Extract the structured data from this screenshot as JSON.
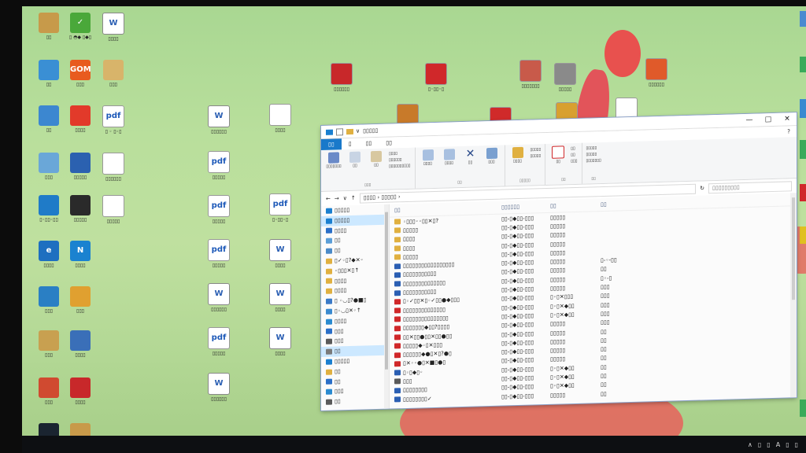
{
  "desktop": {
    "left_icons": [
      {
        "label": "▯▯",
        "glyph": "",
        "color": "#c79a4a",
        "kind": "folder"
      },
      {
        "label": "▯ ◓◆ ▯◆▯",
        "glyph": "✓",
        "color": "#4aa83a",
        "kind": "app"
      },
      {
        "label": "▯▯▯▯",
        "glyph": "W",
        "color": "#ffffff",
        "kind": "doc-w"
      },
      {
        "label": "▯▯",
        "glyph": "",
        "color": "#3a8fd4",
        "kind": "app"
      },
      {
        "label": "▯▯▯",
        "glyph": "GOM",
        "color": "#e85b1f",
        "kind": "app"
      },
      {
        "label": "▯▯▯",
        "glyph": "",
        "color": "#d8b46a",
        "kind": "app"
      },
      {
        "label": "▯▯",
        "glyph": "",
        "color": "#3c87d0",
        "kind": "app"
      },
      {
        "label": "▯▯▯▯",
        "glyph": "",
        "color": "#e23a2a",
        "kind": "app"
      },
      {
        "label": "▯ ◦ ▯◦▯",
        "glyph": "pdf",
        "color": "#ffffff",
        "kind": "doc"
      },
      {
        "label": "▯▯▯",
        "glyph": "",
        "color": "#6aa7d8",
        "kind": "app"
      },
      {
        "label": "▯▯▯▯▯",
        "glyph": "",
        "color": "#2b61b0",
        "kind": "app"
      },
      {
        "label": "▯▯▯▯▯▯",
        "glyph": "",
        "color": "#ffffff",
        "kind": "doc"
      },
      {
        "label": "▯◦▯▯◦▯▯",
        "glyph": "",
        "color": "#1f7bc8",
        "kind": "app"
      },
      {
        "label": "▯▯▯▯▯",
        "glyph": "",
        "color": "#2a2a2a",
        "kind": "app"
      },
      {
        "label": "▯▯▯▯▯",
        "glyph": "",
        "color": "#ffffff",
        "kind": "doc"
      },
      {
        "label": "▯▯▯▯",
        "glyph": "e",
        "color": "#1e6fc0",
        "kind": "app"
      },
      {
        "label": "▯▯▯▯",
        "glyph": "N",
        "color": "#1a82d0",
        "kind": "app"
      },
      {
        "label": "▯▯▯",
        "glyph": "",
        "color": "#2a7fc4",
        "kind": "app"
      },
      {
        "label": "▯▯▯",
        "glyph": "",
        "color": "#e0a030",
        "kind": "app"
      },
      {
        "label": "▯▯▯",
        "glyph": "",
        "color": "#c8a050",
        "kind": "folder"
      },
      {
        "label": "▯▯▯▯",
        "glyph": "",
        "color": "#3a6fb8",
        "kind": "app"
      },
      {
        "label": "▯▯▯",
        "glyph": "",
        "color": "#d04a30",
        "kind": "app"
      },
      {
        "label": "▯▯▯▯",
        "glyph": "",
        "color": "#c8282a",
        "kind": "app"
      },
      {
        "label": "▯▯▯",
        "glyph": "",
        "color": "#1a2430",
        "kind": "app"
      },
      {
        "label": "▯▯▯",
        "glyph": "",
        "color": "#c89a4a",
        "kind": "folder"
      }
    ],
    "mid_icons": [
      {
        "label": "▯▯▯▯▯▯",
        "glyph": "W",
        "kind": "doc-w"
      },
      {
        "label": "▯▯▯▯",
        "glyph": "",
        "kind": "doc"
      },
      {
        "label": "▯▯▯▯▯",
        "glyph": "pdf",
        "kind": "doc"
      },
      {
        "label": "▯▯▯▯▯",
        "glyph": "pdf",
        "kind": "doc"
      },
      {
        "label": "▯◦▯▯◦▯",
        "glyph": "pdf",
        "kind": "doc"
      },
      {
        "label": "▯▯▯▯▯",
        "glyph": "pdf",
        "kind": "doc"
      },
      {
        "label": "▯▯▯▯",
        "glyph": "W",
        "kind": "doc-w"
      },
      {
        "label": "▯▯▯▯▯▯",
        "glyph": "W",
        "kind": "doc-w"
      },
      {
        "label": "▯▯▯▯",
        "glyph": "W",
        "kind": "doc-w"
      },
      {
        "label": "▯▯▯▯▯",
        "glyph": "pdf",
        "kind": "doc"
      },
      {
        "label": "▯▯▯▯",
        "glyph": "W",
        "kind": "doc-w"
      },
      {
        "label": "▯▯▯▯▯▯",
        "glyph": "W",
        "kind": "doc-w"
      }
    ],
    "top_icons": [
      {
        "label": "▯▯▯▯▯▯",
        "color": "#c8282a"
      },
      {
        "label": "▯◦▯▯◦▯",
        "color": "#d0282a"
      },
      {
        "label": "▯▯▯▯▯▯▯",
        "color": "#c85a4a"
      },
      {
        "label": "▯▯▯▯▯",
        "color": "#8a8a8a"
      },
      {
        "label": "▯▯▯▯▯▯",
        "color": "#e05a2a"
      },
      {
        "label": "▯▯",
        "color": "#c87a2a"
      },
      {
        "label": "▯▯▯▯",
        "color": "#d02a2a"
      },
      {
        "label": "▯▯▯",
        "color": "#d8a030"
      },
      {
        "label": "▯▯▯▯",
        "color": "#ffffff"
      }
    ]
  },
  "explorer": {
    "title": "▯▯▯▯▯",
    "titlebar_icons": [
      "folder-icon",
      "check-icon",
      "folder-icon",
      "chevron-down-icon"
    ],
    "window_buttons": [
      "—",
      "□",
      "✕"
    ],
    "tabs": [
      "▯▯",
      "▯",
      "▯▯",
      "▯▯"
    ],
    "ribbon": {
      "clipboard": {
        "pin": "▯▯▯▯▯▯▯",
        "copy": "▯▯",
        "paste": "▯▯",
        "cut": "▯▯▯▯",
        "copy_path": "▯▯▯▯▯▯",
        "paste_shortcut": "▯▯▯▯▯▯▯▯▯▯",
        "group": "▯▯▯"
      },
      "organize": {
        "move": "▯▯▯▯",
        "copy": "▯▯▯▯",
        "delete": "▯▯",
        "rename": "▯▯▯",
        "group": "▯▯"
      },
      "new": {
        "new_folder": "▯▯▯▯",
        "new_item": "▯▯▯▯▯",
        "easy_access": "▯▯▯▯▯",
        "group": "▯▯▯▯▯"
      },
      "open": {
        "properties": "▯▯",
        "open": "▯▯",
        "edit": "▯▯",
        "history": "▯▯▯",
        "group": "▯▯"
      },
      "select": {
        "select_all": "▯▯▯▯▯",
        "select_none": "▯▯▯▯▯",
        "invert": "▯▯▯▯▯▯▯",
        "group": "▯▯"
      }
    },
    "address": {
      "nav": [
        "←",
        "→",
        "∨",
        "↑"
      ],
      "path": "▯▯▯▯ › ▯▯▯▯▯ ›",
      "search_placeholder": "▯▯▯▯▯▯▯▯▯"
    },
    "nav_pane": [
      {
        "label": "▯▯▯▯▯",
        "color": "#1a7fd0",
        "sel": false
      },
      {
        "label": "▯▯▯▯▯",
        "color": "#1a7fd0",
        "sel": true
      },
      {
        "label": "▯▯▯▯",
        "color": "#2a6fc8",
        "sel": false
      },
      {
        "label": "▯▯",
        "color": "#5a9ed8",
        "sel": false
      },
      {
        "label": "▯▯",
        "color": "#4a8ac8",
        "sel": false
      },
      {
        "label": "▯✓◦▯?◆✕◦",
        "color": "#e0b040",
        "sel": false
      },
      {
        "label": "◦▯▯▯✕▯↑",
        "color": "#e0b040",
        "sel": false
      },
      {
        "label": "▯▯▯▯",
        "color": "#e0b040",
        "sel": false
      },
      {
        "label": "▯▯▯▯",
        "color": "#e0b040",
        "sel": false
      },
      {
        "label": "▯ ◦◡▯?●■▯",
        "color": "#3a7ac8",
        "sel": false
      },
      {
        "label": "▯◦◡▯✕◦↑",
        "color": "#3a8ad0",
        "sel": false
      },
      {
        "label": "▯▯▯▯",
        "color": "#2a8ad0",
        "sel": false
      },
      {
        "label": "▯▯▯",
        "color": "#2a6fc8",
        "sel": false
      },
      {
        "label": "▯▯▯",
        "color": "#5a5a5a",
        "sel": false
      },
      {
        "label": "▯▯",
        "color": "#7a7a7a",
        "sel": true
      },
      {
        "label": "▯▯▯▯▯",
        "color": "#1a7fd0",
        "sel": false
      },
      {
        "label": "▯▯",
        "color": "#e0b040",
        "sel": false
      },
      {
        "label": "▯▯",
        "color": "#2a6fc8",
        "sel": false
      },
      {
        "label": "▯▯▯",
        "color": "#2a8ad0",
        "sel": false
      },
      {
        "label": "▯▯",
        "color": "#5a5a5a",
        "sel": false
      }
    ],
    "columns": [
      "▯▯",
      "▯▯▯▯▯▯",
      "▯▯",
      "▯▯"
    ],
    "files": [
      {
        "name": "◦▯▯▯◦◦▯▯✕▯?",
        "date": "▯▯-▯◆▯▯-▯▯▯",
        "type": "▯▯▯▯▯",
        "size": "",
        "icon": "#e0b040"
      },
      {
        "name": "▯▯▯▯▯",
        "date": "▯▯-▯◆▯▯-▯▯▯",
        "type": "▯▯▯▯▯",
        "size": "",
        "icon": "#e0b040"
      },
      {
        "name": "▯▯▯▯",
        "date": "▯▯-▯◆▯▯-▯▯▯",
        "type": "▯▯▯▯▯",
        "size": "",
        "icon": "#e0b040"
      },
      {
        "name": "▯▯▯▯",
        "date": "▯▯-▯◆▯▯-▯▯▯",
        "type": "▯▯▯▯▯",
        "size": "",
        "icon": "#e0b040"
      },
      {
        "name": "▯▯▯▯▯",
        "date": "▯▯-▯◆▯▯-▯▯▯",
        "type": "▯▯▯▯▯",
        "size": "",
        "icon": "#e0b040"
      },
      {
        "name": "▯▯▯▯▯▯▯▯▯▯▯▯▯▯▯▯▯",
        "date": "▯▯-▯◆▯▯-▯▯▯",
        "type": "▯▯▯▯▯",
        "size": "▯-◦-▯▯",
        "icon": "#2b5fb3"
      },
      {
        "name": "▯▯▯▯▯▯▯▯▯▯▯",
        "date": "▯▯-▯◆▯▯-▯▯▯",
        "type": "▯▯▯▯▯",
        "size": "▯▯",
        "icon": "#2b5fb3"
      },
      {
        "name": "▯▯▯▯▯▯▯▯▯▯▯▯▯▯",
        "date": "▯▯-▯◆▯▯-▯▯▯",
        "type": "▯▯▯▯▯",
        "size": "▯◦-▯",
        "icon": "#2b5fb3"
      },
      {
        "name": "▯▯▯▯▯▯▯▯▯▯▯",
        "date": "▯▯-▯◆▯▯-▯▯▯",
        "type": "▯▯▯▯▯",
        "size": "▯▯▯",
        "icon": "#2b5fb3"
      },
      {
        "name": "▯◦✓▯▯✕▯◦✓▯▯●◆▯▯▯",
        "date": "▯▯-▯◆▯▯-▯▯▯",
        "type": "▯◦▯✕▯▯▯",
        "size": "▯▯▯",
        "icon": "#d0282a"
      },
      {
        "name": "▯▯▯▯▯▯▯▯▯▯▯▯▯▯",
        "date": "▯▯-▯◆▯▯-▯▯▯",
        "type": "▯◦▯✕◆▯▯",
        "size": "▯▯▯",
        "icon": "#d0282a"
      },
      {
        "name": "▯▯▯▯▯▯▯▯▯▯▯▯▯▯▯",
        "date": "▯▯-▯◆▯▯-▯▯▯",
        "type": "▯◦▯✕◆▯▯",
        "size": "▯▯▯",
        "icon": "#d0282a"
      },
      {
        "name": "▯▯▯▯▯▯▯◆▯▯?▯▯▯▯",
        "date": "▯▯-▯◆▯▯-▯▯▯",
        "type": "▯▯▯▯▯",
        "size": "▯▯▯",
        "icon": "#d0282a"
      },
      {
        "name": "▯▯✕▯▯●▯▯✕▯▯●▯▯",
        "date": "▯▯-▯◆▯▯-▯▯▯",
        "type": "▯▯▯▯▯",
        "size": "▯▯",
        "icon": "#d0282a"
      },
      {
        "name": "▯▯▯▯▯◆◦▯✕▯▯▯",
        "date": "▯▯-▯◆▯▯-▯▯▯",
        "type": "▯▯▯▯▯",
        "size": "▯▯",
        "icon": "#d0282a"
      },
      {
        "name": "▯▯▯▯▯▯◆●▯✕▯?●▯",
        "date": "▯▯-▯◆▯▯-▯▯▯",
        "type": "▯▯▯▯▯",
        "size": "▯▯",
        "icon": "#d0282a"
      },
      {
        "name": "▯✕◦◦●▯✕■▯●▯",
        "date": "▯▯-▯◆▯▯-▯▯▯",
        "type": "▯▯▯▯▯",
        "size": "▯▯",
        "icon": "#d0282a"
      },
      {
        "name": "▯◦▯◆▯◦",
        "date": "▯▯-▯◆▯▯-▯▯▯",
        "type": "▯◦▯✕◆▯▯",
        "size": "▯▯",
        "icon": "#2b5fb3"
      },
      {
        "name": "▯▯▯",
        "date": "▯▯-▯◆▯▯-▯▯▯",
        "type": "▯◦▯✕◆▯▯",
        "size": "▯▯",
        "icon": "#5a5a5a"
      },
      {
        "name": "▯▯▯▯▯▯▯▯",
        "date": "▯▯-▯◆▯▯-▯▯▯",
        "type": "▯◦▯✕◆▯▯",
        "size": "▯▯",
        "icon": "#2b5fb3"
      },
      {
        "name": "▯▯▯▯▯▯▯▯✓",
        "date": "▯▯-▯◆▯▯-▯▯▯",
        "type": "▯▯▯▯▯",
        "size": "▯▯",
        "icon": "#2b5fb3"
      }
    ]
  },
  "tray": {
    "items": [
      "∧",
      "▯",
      "▯",
      "A",
      "▯",
      "▯"
    ]
  }
}
